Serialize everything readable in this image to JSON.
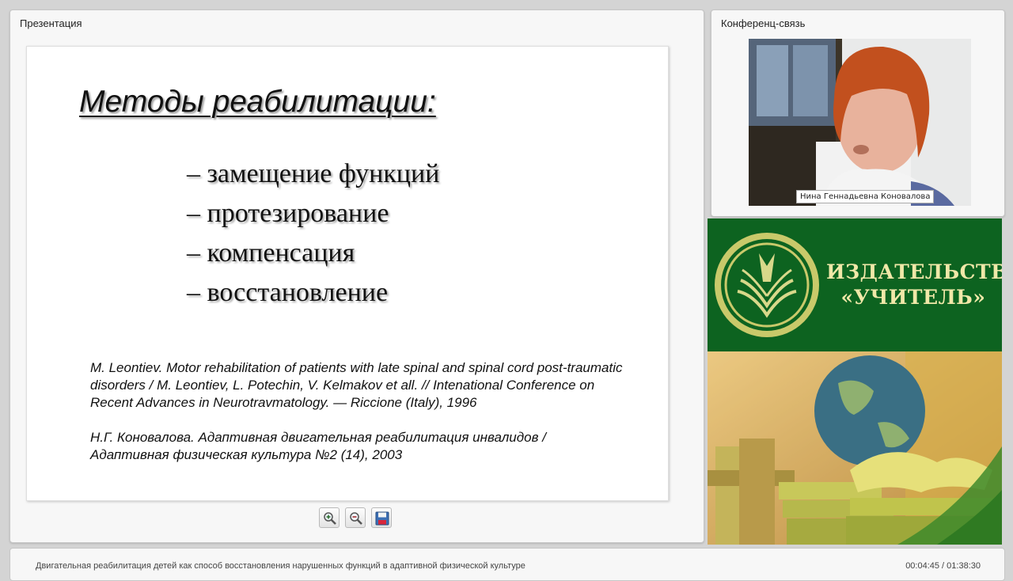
{
  "presentation": {
    "title": "Презентация",
    "slide": {
      "heading": "Методы реабилитации:",
      "methods": [
        "– замещение функций",
        "– протезирование",
        "– компенсация",
        "– восстановление"
      ],
      "references": [
        "M. Leontiev. Motor rehabilitation of patients with late spinal and spinal cord post-traumatic disorders / M. Leontiev, L. Potechin, V. Kelmakov et all. // Intenational Conference on Recent Advances in Neurotravmatology. — Riccione (Italy), 1996",
        "Н.Г. Коновалова. Адаптивная двигательная реабилитация инвалидов / Адаптивная физическая культура №2 (14), 2003"
      ]
    },
    "toolbar": {
      "zoom_in": "zoom-in-icon",
      "zoom_out": "zoom-out-icon",
      "save": "save-icon"
    }
  },
  "conference": {
    "title": "Конференц-связь",
    "speaker_name": "Нина Геннадьевна Коновалова"
  },
  "ad": {
    "publisher_line1": "ИЗДАТЕЛЬСТВО",
    "publisher_line2": "«УЧИТЕЛЬ»",
    "colors": {
      "green": "#0d6320",
      "gold": "#f0e8a8"
    }
  },
  "footer": {
    "course_title": "Двигательная реабилитация детей как способ  восстановления нарушенных функций в адаптивной физической культуре",
    "timecode": "00:04:45 / 01:38:30"
  }
}
